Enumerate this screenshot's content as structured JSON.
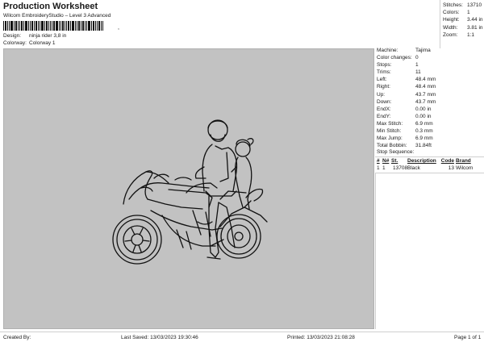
{
  "header": {
    "title": "Production Worksheet",
    "subtitle": "Wilcom EmbroideryStudio – Level 3 Advanced",
    "barcode_tail": ",",
    "design_label": "Design:",
    "design_value": "ninja rider 3,8 in",
    "colorway_label": "Colorway:",
    "colorway_value": "Colorway 1"
  },
  "stats": [
    {
      "label": "Stitches:",
      "value": "13710"
    },
    {
      "label": "Colors:",
      "value": "1"
    },
    {
      "label": "Height:",
      "value": "3.44 in"
    },
    {
      "label": "Width:",
      "value": "3.81 in"
    },
    {
      "label": "Zoom:",
      "value": "1:1"
    }
  ],
  "machine_info": [
    {
      "label": "Machine:",
      "value": "Tajima"
    },
    {
      "label": "Color changes:",
      "value": "0"
    },
    {
      "label": "Stops:",
      "value": "1"
    },
    {
      "label": "Trims:",
      "value": "11"
    },
    {
      "label": "Left:",
      "value": "48.4 mm"
    },
    {
      "label": "Right:",
      "value": "48.4 mm"
    },
    {
      "label": "Up:",
      "value": "43.7 mm"
    },
    {
      "label": "Down:",
      "value": "43.7 mm"
    },
    {
      "label": "EndX:",
      "value": "0.00 in"
    },
    {
      "label": "EndY:",
      "value": "0.00 in"
    },
    {
      "label": "Max Stitch:",
      "value": "6.9 mm"
    },
    {
      "label": "Min Stitch:",
      "value": "0.3 mm"
    },
    {
      "label": "Max Jump:",
      "value": "6.9 mm"
    },
    {
      "label": "Total Bobbin:",
      "value": "31.84ft"
    }
  ],
  "stop_sequence": {
    "title": "Stop Sequence:",
    "columns": [
      "#",
      "N#",
      "St.",
      "Description",
      "Code",
      "Brand"
    ],
    "rows": [
      {
        "num": "1",
        "n": "1",
        "stitches": "13708",
        "description": "Black",
        "code": "13",
        "brand": "Wilcom",
        "color": "#111111"
      }
    ]
  },
  "footer": {
    "created_by": "Created By:",
    "last_saved": "Last Saved: 13/03/2023 19:30:46",
    "printed": "Printed: 13/03/2023 21:08:28",
    "page": "Page 1 of 1"
  },
  "colors": {
    "canvas_bg": "#c2c2c2",
    "thread": "#111111"
  }
}
